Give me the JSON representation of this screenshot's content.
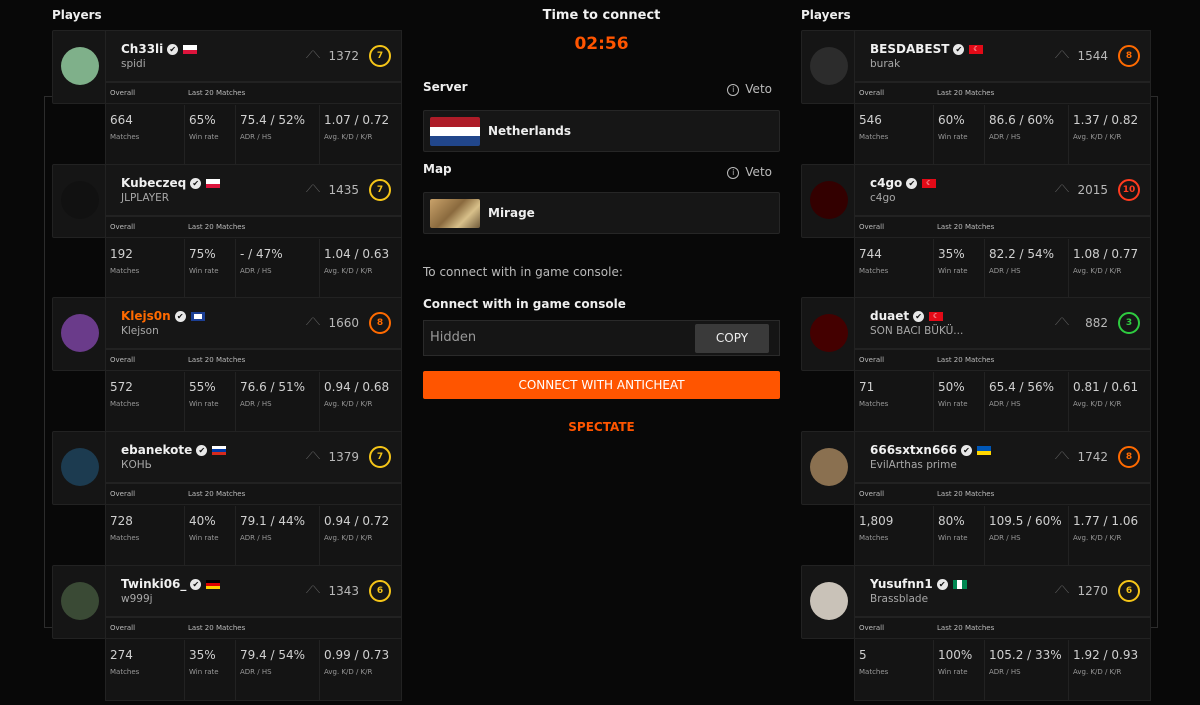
{
  "left_team": {
    "label": "Players",
    "players": [
      {
        "name": "Ch33li",
        "sub": "spidi",
        "elo": "1372",
        "level": "7",
        "level_color": "#f5c518",
        "name_color": "#f0f0f0",
        "flag": "poland",
        "stats": {
          "overall_label": "Overall",
          "recent_label": "Last 20 Matches",
          "matches": "664",
          "matches_label": "Matches",
          "winrate": "65%",
          "winrate_label": "Win rate",
          "adr_hs": "75.4 / 52%",
          "adr_hs_label": "ADR / HS",
          "kd_kr": "1.07 / 0.72",
          "kd_kr_label": "Avg. K/D / K/R"
        }
      },
      {
        "name": "Kubeczeq",
        "sub": "JLPLAYER",
        "elo": "1435",
        "level": "7",
        "level_color": "#f5c518",
        "name_color": "#f0f0f0",
        "flag": "poland",
        "stats": {
          "overall_label": "Overall",
          "recent_label": "Last 20 Matches",
          "matches": "192",
          "matches_label": "Matches",
          "winrate": "75%",
          "winrate_label": "Win rate",
          "adr_hs": "- / 47%",
          "adr_hs_label": "ADR / HS",
          "kd_kr": "1.04 / 0.63",
          "kd_kr_label": "Avg. K/D / K/R"
        }
      },
      {
        "name": "Klejs0n",
        "sub": "Klejson",
        "elo": "1660",
        "level": "8",
        "level_color": "#ff6a00",
        "name_color": "#ff6a00",
        "flag": "misc",
        "stats": {
          "overall_label": "Overall",
          "recent_label": "Last 20 Matches",
          "matches": "572",
          "matches_label": "Matches",
          "winrate": "55%",
          "winrate_label": "Win rate",
          "adr_hs": "76.6 / 51%",
          "adr_hs_label": "ADR / HS",
          "kd_kr": "0.94 / 0.68",
          "kd_kr_label": "Avg. K/D / K/R"
        }
      },
      {
        "name": "ebanekote",
        "sub": "КОНЬ",
        "elo": "1379",
        "level": "7",
        "level_color": "#f5c518",
        "name_color": "#f0f0f0",
        "flag": "russia",
        "stats": {
          "overall_label": "Overall",
          "recent_label": "Last 20 Matches",
          "matches": "728",
          "matches_label": "Matches",
          "winrate": "40%",
          "winrate_label": "Win rate",
          "adr_hs": "79.1 / 44%",
          "adr_hs_label": "ADR / HS",
          "kd_kr": "0.94 / 0.72",
          "kd_kr_label": "Avg. K/D / K/R"
        }
      },
      {
        "name": "Twinki06_",
        "sub": "w999j",
        "elo": "1343",
        "level": "6",
        "level_color": "#f5c518",
        "name_color": "#f0f0f0",
        "flag": "germany",
        "stats": {
          "overall_label": "Overall",
          "recent_label": "Last 20 Matches",
          "matches": "274",
          "matches_label": "Matches",
          "winrate": "35%",
          "winrate_label": "Win rate",
          "adr_hs": "79.4 / 54%",
          "adr_hs_label": "ADR / HS",
          "kd_kr": "0.99 / 0.73",
          "kd_kr_label": "Avg. K/D / K/R"
        }
      }
    ]
  },
  "right_team": {
    "label": "Players",
    "players": [
      {
        "name": "BESDABEST",
        "sub": "burak",
        "elo": "1544",
        "level": "8",
        "level_color": "#ff6a00",
        "name_color": "#f0f0f0",
        "flag": "turkey",
        "stats": {
          "overall_label": "Overall",
          "recent_label": "Last 20 Matches",
          "matches": "546",
          "matches_label": "Matches",
          "winrate": "60%",
          "winrate_label": "Win rate",
          "adr_hs": "86.6 / 60%",
          "adr_hs_label": "ADR / HS",
          "kd_kr": "1.37 / 0.82",
          "kd_kr_label": "Avg. K/D / K/R"
        }
      },
      {
        "name": "c4go",
        "sub": "c4go",
        "elo": "2015",
        "level": "10",
        "level_color": "#ff3b1f",
        "name_color": "#f0f0f0",
        "flag": "turkey",
        "stats": {
          "overall_label": "Overall",
          "recent_label": "Last 20 Matches",
          "matches": "744",
          "matches_label": "Matches",
          "winrate": "35%",
          "winrate_label": "Win rate",
          "adr_hs": "82.2 / 54%",
          "adr_hs_label": "ADR / HS",
          "kd_kr": "1.08 / 0.77",
          "kd_kr_label": "Avg. K/D / K/R"
        }
      },
      {
        "name": "duaet",
        "sub": "SON BACI BÜKÜ...",
        "elo": "882",
        "level": "3",
        "level_color": "#2ecc40",
        "name_color": "#f0f0f0",
        "flag": "turkey",
        "stats": {
          "overall_label": "Overall",
          "recent_label": "Last 20 Matches",
          "matches": "71",
          "matches_label": "Matches",
          "winrate": "50%",
          "winrate_label": "Win rate",
          "adr_hs": "65.4 / 56%",
          "adr_hs_label": "ADR / HS",
          "kd_kr": "0.81 / 0.61",
          "kd_kr_label": "Avg. K/D / K/R"
        }
      },
      {
        "name": "666sxtxn666",
        "sub": "EvilArthas prime",
        "elo": "1742",
        "level": "8",
        "level_color": "#ff6a00",
        "name_color": "#f0f0f0",
        "flag": "ukraine",
        "stats": {
          "overall_label": "Overall",
          "recent_label": "Last 20 Matches",
          "matches": "1,809",
          "matches_label": "Matches",
          "winrate": "80%",
          "winrate_label": "Win rate",
          "adr_hs": "109.5 / 60%",
          "adr_hs_label": "ADR / HS",
          "kd_kr": "1.77 / 1.06",
          "kd_kr_label": "Avg. K/D / K/R"
        }
      },
      {
        "name": "Yusufnn1",
        "sub": "Brassblade",
        "elo": "1270",
        "level": "6",
        "level_color": "#f5c518",
        "name_color": "#f0f0f0",
        "flag": "nigeria",
        "stats": {
          "overall_label": "Overall",
          "recent_label": "Last 20 Matches",
          "matches": "5",
          "matches_label": "Matches",
          "winrate": "100%",
          "winrate_label": "Win rate",
          "adr_hs": "105.2 / 33%",
          "adr_hs_label": "ADR / HS",
          "kd_kr": "1.92 / 0.93",
          "kd_kr_label": "Avg. K/D / K/R"
        }
      }
    ]
  },
  "center": {
    "title": "Time to connect",
    "timer": "02:56",
    "server_label": "Server",
    "server_veto": "Veto",
    "server_value": "Netherlands",
    "map_label": "Map",
    "map_veto": "Veto",
    "map_value": "Mirage",
    "connect_hint": "To connect with in game console:",
    "console_label": "Connect with in game console",
    "console_value": "Hidden",
    "copy_label": "COPY",
    "anticheat_label": "CONNECT WITH ANTICHEAT",
    "spectate_label": "SPECTATE",
    "accent_color": "#ff5500"
  }
}
